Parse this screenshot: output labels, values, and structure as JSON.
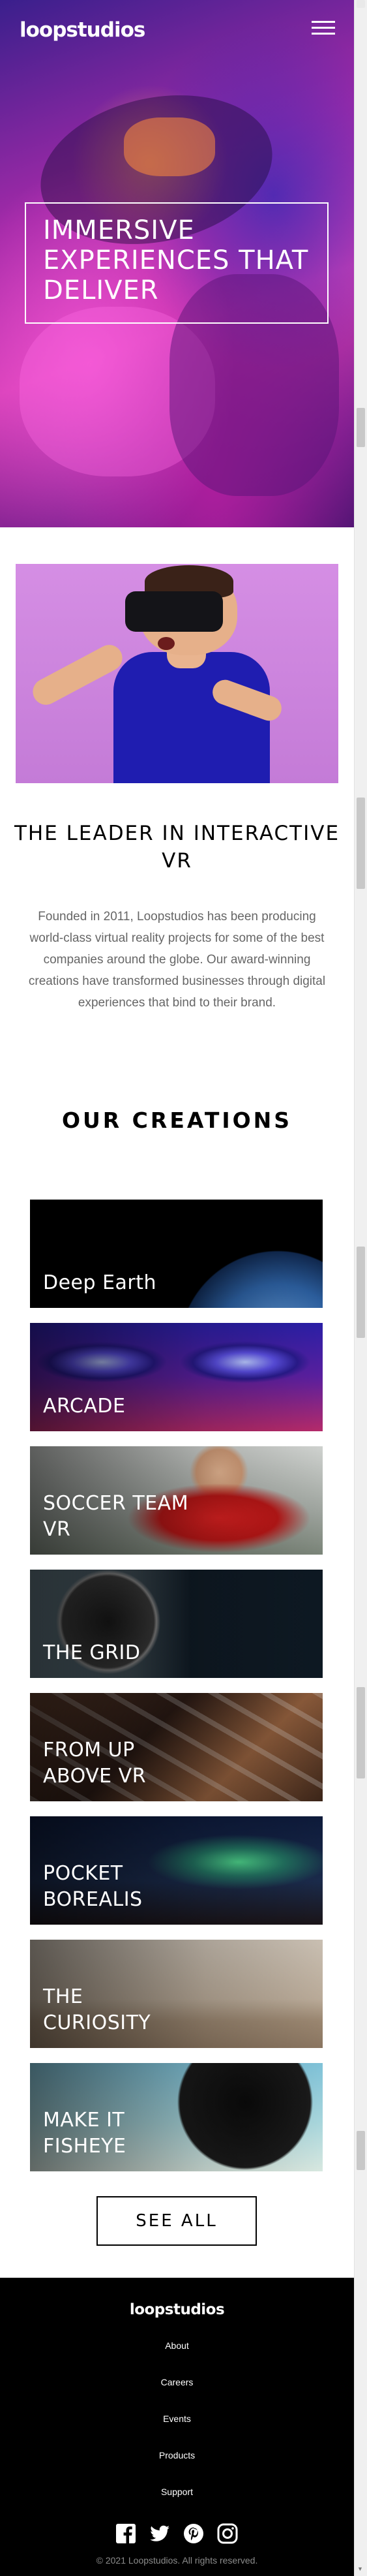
{
  "header": {
    "logo": "loopstudios",
    "menu_icon": "hamburger-menu-icon"
  },
  "hero": {
    "title": "IMMERSIVE EXPERIENCES THAT DELIVER"
  },
  "interactive": {
    "title": "THE LEADER IN INTERACTIVE VR",
    "text": "Founded in 2011, Loopstudios has been producing world-class virtual reality projects for some of the best companies around the globe. Our award-winning creations have transformed businesses through digital experiences that bind to their brand."
  },
  "creations": {
    "title": "OUR CREATIONS",
    "items": [
      {
        "label": "Deep Earth"
      },
      {
        "label": "ARCADE"
      },
      {
        "label": "SOCCER TEAM VR"
      },
      {
        "label": "THE GRID"
      },
      {
        "label": "FROM UP ABOVE VR"
      },
      {
        "label": "POCKET BOREALIS"
      },
      {
        "label": "THE CURIOSITY"
      },
      {
        "label": "MAKE IT FISHEYE"
      }
    ],
    "see_all": "SEE ALL"
  },
  "footer": {
    "logo": "loopstudios",
    "links": [
      "About",
      "Careers",
      "Events",
      "Products",
      "Support"
    ],
    "socials": [
      "facebook-icon",
      "twitter-icon",
      "pinterest-icon",
      "instagram-icon"
    ],
    "copyright": "© 2021 Loopstudios. All rights reserved."
  },
  "colors": {
    "hero_accent": "#c53bb5",
    "footer_bg": "#000000",
    "text_muted": "#666666"
  }
}
